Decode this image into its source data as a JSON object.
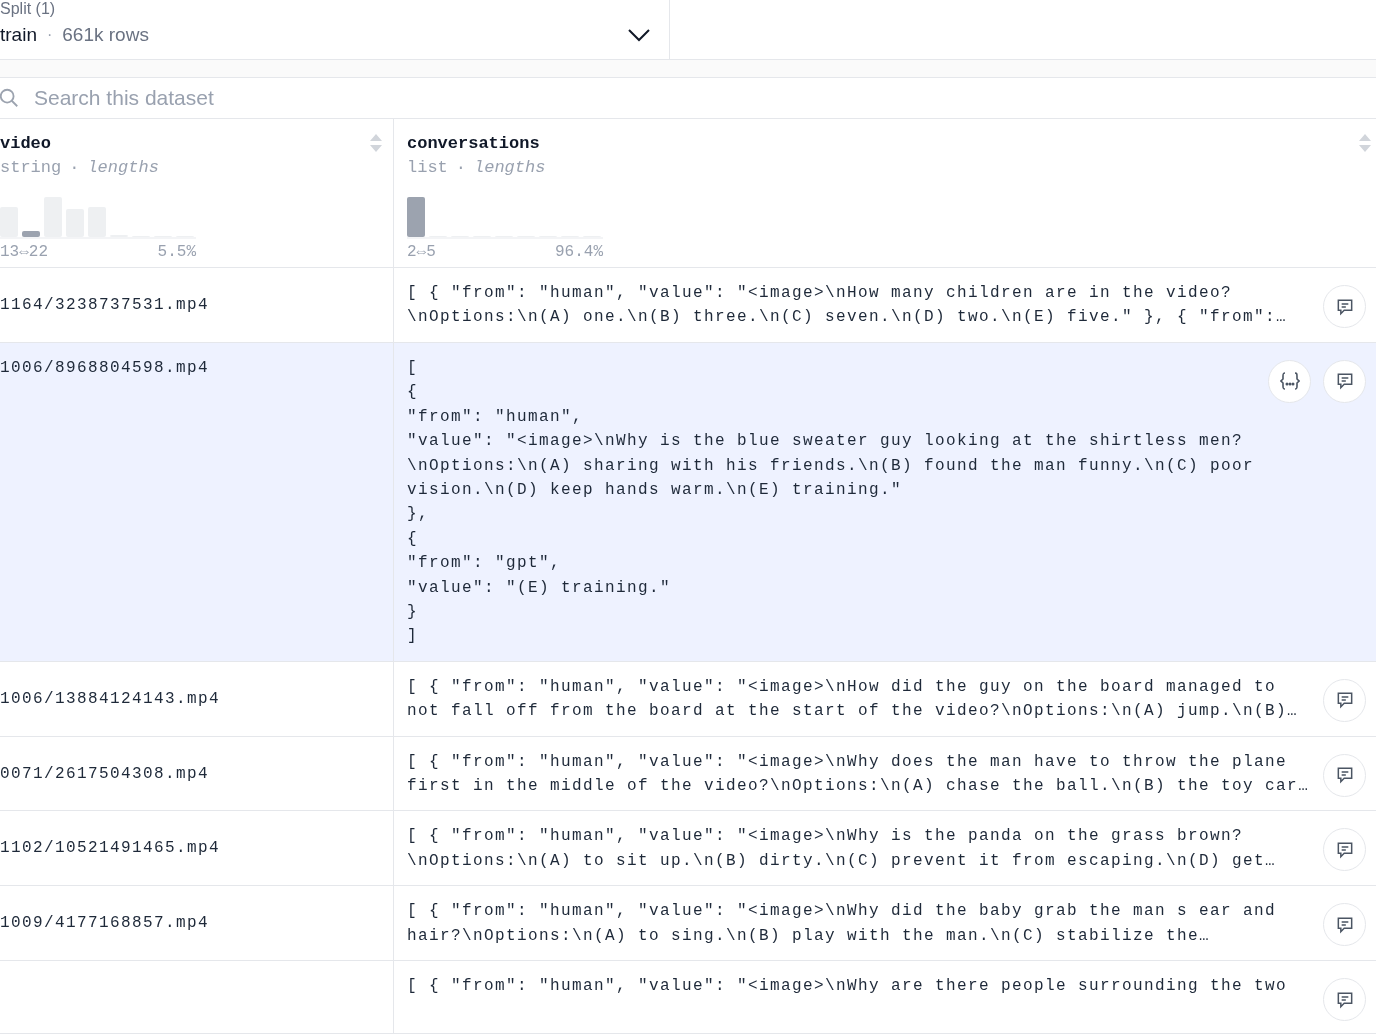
{
  "split": {
    "label": "Split (1)",
    "value": "train",
    "separator": "·",
    "rows": "661k rows"
  },
  "search": {
    "placeholder": "Search this dataset"
  },
  "columns": [
    {
      "name": "video",
      "type": "string",
      "separator": "·",
      "stat": "lengths",
      "range": "13⇔22",
      "percent": "5.5%"
    },
    {
      "name": "conversations",
      "type": "list",
      "separator": "·",
      "stat": "lengths",
      "range": "2⇔5",
      "percent": "96.4%"
    }
  ],
  "rows": [
    {
      "video": "1164/3238737531.mp4",
      "selected": false,
      "lines": [
        "[ { \"from\": \"human\", \"value\": \"<image>\\nHow many children are in the video?",
        "\\nOptions:\\n(A) one.\\n(B) three.\\n(C) seven.\\n(D) two.\\n(E) five.\" }, { \"from\":…"
      ]
    },
    {
      "video": "1006/8968804598.mp4",
      "selected": true,
      "lines": [
        "[",
        "{",
        "\"from\": \"human\",",
        "\"value\": \"<image>\\nWhy is the blue sweater guy looking at the shirtless men?",
        "\\nOptions:\\n(A) sharing with his friends.\\n(B) found the man funny.\\n(C) poor",
        "vision.\\n(D) keep hands warm.\\n(E) training.\"",
        "},",
        "{",
        "\"from\": \"gpt\",",
        "\"value\": \"(E) training.\"",
        "}",
        "]"
      ]
    },
    {
      "video": "1006/13884124143.mp4",
      "selected": false,
      "lines": [
        "[ { \"from\": \"human\", \"value\": \"<image>\\nHow did the guy on the board managed to",
        "not fall off from the board at the start of the video?\\nOptions:\\n(A) jump.\\n(B)…"
      ]
    },
    {
      "video": "0071/2617504308.mp4",
      "selected": false,
      "lines": [
        "[ { \"from\": \"human\", \"value\": \"<image>\\nWhy does the man have to throw the plane",
        "first in the middle of the video?\\nOptions:\\n(A) chase the ball.\\n(B) the toy car…"
      ]
    },
    {
      "video": "1102/10521491465.mp4",
      "selected": false,
      "lines": [
        "[ { \"from\": \"human\", \"value\": \"<image>\\nWhy is the panda on the grass brown?",
        "\\nOptions:\\n(A) to sit up.\\n(B) dirty.\\n(C) prevent it from escaping.\\n(D) get…"
      ]
    },
    {
      "video": "1009/4177168857.mp4",
      "selected": false,
      "lines": [
        "[ { \"from\": \"human\", \"value\": \"<image>\\nWhy did the baby grab the man s ear and",
        "hair?\\nOptions:\\n(A) to sing.\\n(B) play with the man.\\n(C) stabilize the…"
      ]
    },
    {
      "selected": false,
      "lines": [
        "[ { \"from\": \"human\", \"value\": \"<image>\\nWhy are there people surrounding the two"
      ]
    }
  ]
}
